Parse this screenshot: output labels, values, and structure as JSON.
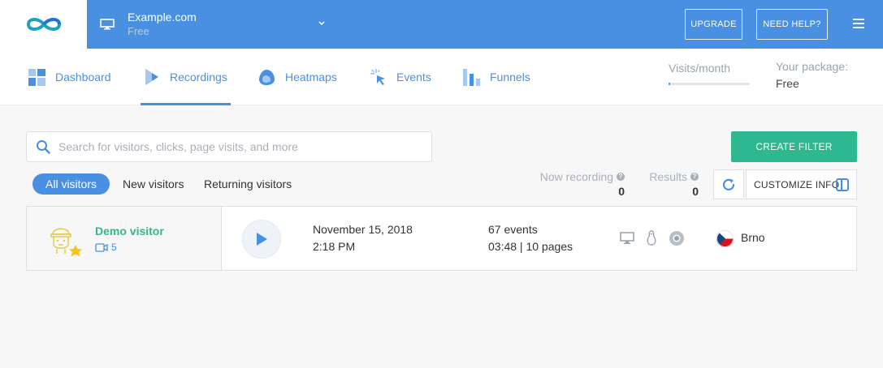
{
  "colors": {
    "brand_blue": "#4a90e2",
    "accent_green": "#2eb88f",
    "background": "#f7f7f7"
  },
  "header": {
    "logo_icon": "infinity-logo-icon",
    "site_name": "Example.com",
    "site_plan": "Free",
    "upgrade_label": "UPGRADE",
    "help_label": "NEED HELP?"
  },
  "nav": {
    "items": [
      {
        "label": "Dashboard",
        "icon": "dashboard-icon"
      },
      {
        "label": "Recordings",
        "icon": "recordings-icon",
        "active": true
      },
      {
        "label": "Heatmaps",
        "icon": "heatmaps-icon"
      },
      {
        "label": "Events",
        "icon": "events-icon"
      },
      {
        "label": "Funnels",
        "icon": "funnels-icon"
      }
    ],
    "visits_label": "Visits/month",
    "visits_progress": 0.02,
    "package_label": "Your package:",
    "package_value": "Free"
  },
  "toolbar": {
    "search_placeholder": "Search for visitors, clicks, page visits, and more",
    "search_value": "",
    "create_filter_label": "CREATE FILTER",
    "segments": [
      "All visitors",
      "New visitors",
      "Returning visitors"
    ],
    "now_recording_label": "Now recording",
    "now_recording_value": "0",
    "results_label": "Results",
    "results_value": "0",
    "customize_label": "CUSTOMIZE INFO"
  },
  "recordings": [
    {
      "visitor_name": "Demo visitor",
      "recording_count": "5",
      "date": "November 15, 2018",
      "time": "2:18 PM",
      "events": "67 events",
      "duration_pages": "03:48 | 10 pages",
      "device_icon": "desktop-icon",
      "os_icon": "linux-icon",
      "browser_icon": "chrome-icon",
      "country_icon": "czech-flag-icon",
      "city": "Brno"
    }
  ]
}
